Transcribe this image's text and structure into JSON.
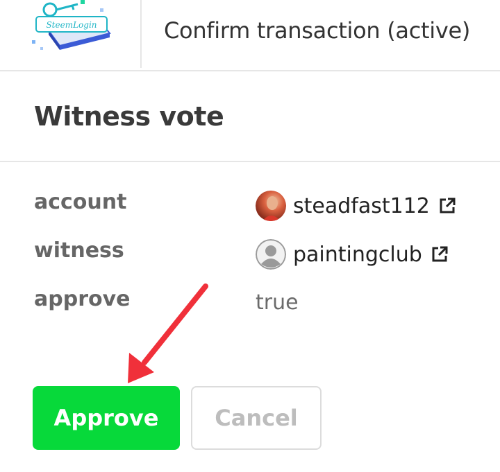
{
  "header": {
    "logo_text": "SteemLogin",
    "title": "Confirm transaction (active)"
  },
  "operation": {
    "title": "Witness vote"
  },
  "fields": [
    {
      "label": "account",
      "value": "steadfast112"
    },
    {
      "label": "witness",
      "value": "paintingclub"
    },
    {
      "label": "approve",
      "value": "true"
    }
  ],
  "buttons": {
    "approve": "Approve",
    "cancel": "Cancel"
  },
  "colors": {
    "approve": "#07d93a",
    "arrow": "#f0303a"
  },
  "icons": {
    "external_link": "external-link-icon",
    "default_avatar": "user-icon"
  }
}
